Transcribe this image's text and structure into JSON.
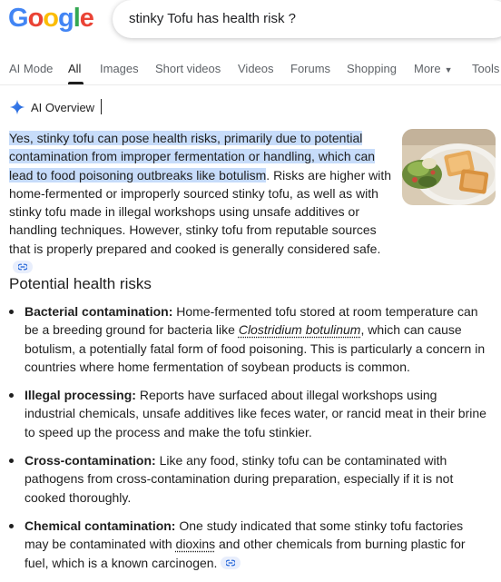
{
  "google_logo": {
    "letters": [
      "G",
      "o",
      "o",
      "g",
      "l",
      "e"
    ],
    "colors": [
      "#4285F4",
      "#EA4335",
      "#FBBC05",
      "#4285F4",
      "#34A853",
      "#EA4335"
    ]
  },
  "search": {
    "query": "stinky Tofu has health risk ?"
  },
  "tabs": [
    {
      "label": "AI Mode"
    },
    {
      "label": "All"
    },
    {
      "label": "Images"
    },
    {
      "label": "Short videos"
    },
    {
      "label": "Videos"
    },
    {
      "label": "Forums"
    },
    {
      "label": "Shopping"
    },
    {
      "label": "More"
    },
    {
      "label": "Tools"
    }
  ],
  "active_tab": "All",
  "ai_overview": {
    "label": "AI Overview",
    "highlight_color": "#c7dcfa",
    "intro_highlight": "Yes, stinky tofu can pose health risks, primarily due to potential contamination from improper fermentation or handling, which can lead to food poisoning outbreaks like botulism",
    "intro_rest": ". Risks are higher with home-fermented or improperly sourced stinky tofu, as well as with stinky tofu made in illegal workshops using unsafe additives or handling techniques. However, stinky tofu from reputable sources that is properly prepared and cooked is generally considered safe."
  },
  "section_title": "Potential health risks",
  "risks": [
    {
      "label": "Bacterial contamination:",
      "text_before": " Home-fermented tofu stored at room temperature can be a breeding ground for bacteria like ",
      "link": "Clostridium botulinum",
      "text_after": ", which can cause botulism, a potentially fatal form of food poisoning. This is particularly a concern in countries where home fermentation of soybean products is common."
    },
    {
      "label": "Illegal processing:",
      "text": " Reports have surfaced about illegal workshops using industrial chemicals, unsafe additives like feces water, or rancid meat in their brine to speed up the process and make the tofu stinkier."
    },
    {
      "label": "Cross-contamination:",
      "text": " Like any food, stinky tofu can be contaminated with pathogens from cross-contamination during preparation, especially if it is not cooked thoroughly."
    },
    {
      "label": "Chemical contamination:",
      "text_before": " One study indicated that some stinky tofu factories may be contaminated with ",
      "link": "dioxins",
      "text_after": " and other chemicals from burning plastic for fuel, which is a known carcinogen."
    }
  ]
}
